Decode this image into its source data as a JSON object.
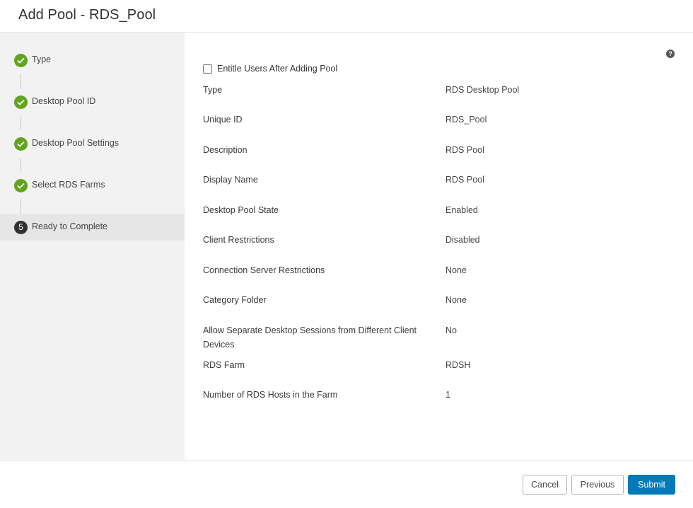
{
  "header": {
    "title": "Add Pool - RDS_Pool"
  },
  "steps": [
    {
      "label": "Type",
      "status": "done"
    },
    {
      "label": "Desktop Pool ID",
      "status": "done"
    },
    {
      "label": "Desktop Pool Settings",
      "status": "done"
    },
    {
      "label": "Select RDS Farms",
      "status": "done"
    },
    {
      "label": "Ready to Complete",
      "status": "current",
      "number": "5"
    }
  ],
  "content": {
    "help_icon": "?",
    "entitle_checkbox": {
      "label": "Entitle Users After Adding Pool",
      "checked": false
    },
    "summary": [
      {
        "key": "Type",
        "value": "RDS Desktop Pool"
      },
      {
        "key": "Unique ID",
        "value": "RDS_Pool"
      },
      {
        "key": "Description",
        "value": "RDS Pool"
      },
      {
        "key": "Display Name",
        "value": "RDS Pool"
      },
      {
        "key": "Desktop Pool State",
        "value": "Enabled"
      },
      {
        "key": "Client Restrictions",
        "value": "Disabled"
      },
      {
        "key": "Connection Server Restrictions",
        "value": "None"
      },
      {
        "key": "Category Folder",
        "value": "None"
      },
      {
        "key": "Allow Separate Desktop Sessions from Different Client Devices",
        "value": "No"
      },
      {
        "key": "RDS Farm",
        "value": "RDSH"
      },
      {
        "key": "Number of RDS Hosts in the Farm",
        "value": "1"
      }
    ]
  },
  "footer": {
    "cancel_label": "Cancel",
    "previous_label": "Previous",
    "submit_label": "Submit"
  },
  "colors": {
    "step_done": "#62a420",
    "step_current": "#313131",
    "primary_button": "#0079b8"
  }
}
